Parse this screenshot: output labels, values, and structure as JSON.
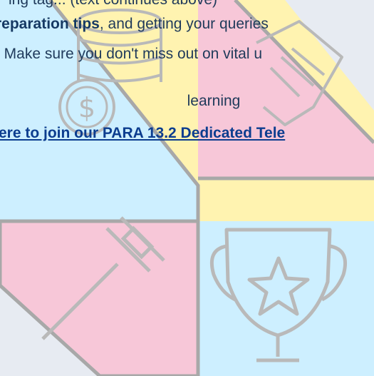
{
  "document": {
    "line1": "ing tag... (text continues above)",
    "line2_bold": "reparation tips",
    "line2_rest": ", and getting your queries",
    "line3": ". Make sure you don't miss out on vital u",
    "line4": "learning",
    "link_text": "ere to join our PARA 13.2 Dedicated Tele"
  },
  "colors": {
    "background": "#e7ebf2",
    "yellow": "#fff3b0",
    "cyan": "#cdefff",
    "pink": "#f7c7d8",
    "outline": "#a8a8a8",
    "link": "#0c3d8f"
  },
  "icons": [
    "coin-stack-icon",
    "dollar-coin-icon",
    "handshake-icon",
    "gavel-icon",
    "trophy-star-icon"
  ]
}
